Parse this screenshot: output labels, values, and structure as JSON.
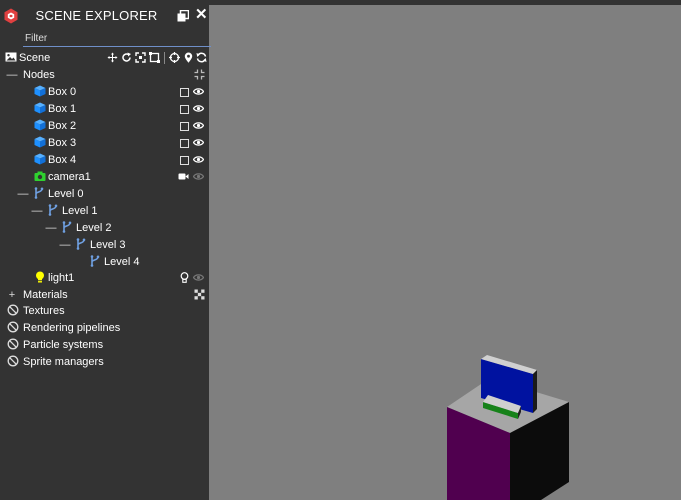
{
  "panel": {
    "title": "SCENE EXPLORER",
    "filter_placeholder": "Filter"
  },
  "tree": {
    "scene_label": "Scene",
    "nodes_label": "Nodes",
    "boxes": [
      "Box 0",
      "Box 1",
      "Box 2",
      "Box 3",
      "Box 4"
    ],
    "camera_label": "camera1",
    "levels": [
      "Level 0",
      "Level 1",
      "Level 2",
      "Level 3",
      "Level 4"
    ],
    "light_label": "light1"
  },
  "sections": {
    "materials": "Materials",
    "textures": "Textures",
    "rendering_pipelines": "Rendering pipelines",
    "particle_systems": "Particle systems",
    "sprite_managers": "Sprite managers"
  },
  "colors": {
    "panel_bg": "#333333",
    "viewport_bg": "#7f7f7f",
    "mesh_icon": "#1e90ff",
    "camera_icon": "#2fd12f",
    "light_icon": "#ffff00",
    "level_icon": "#6f9fe0",
    "accent": "#e04040"
  },
  "icons": {
    "logo": "babylon-logo-icon",
    "scene": "image-icon",
    "mesh": "cube-icon",
    "transform": "branch-icon",
    "camera": "camera-icon",
    "light": "lightbulb-icon",
    "visibility": "eye-icon",
    "disabled_section": "ban-icon"
  }
}
